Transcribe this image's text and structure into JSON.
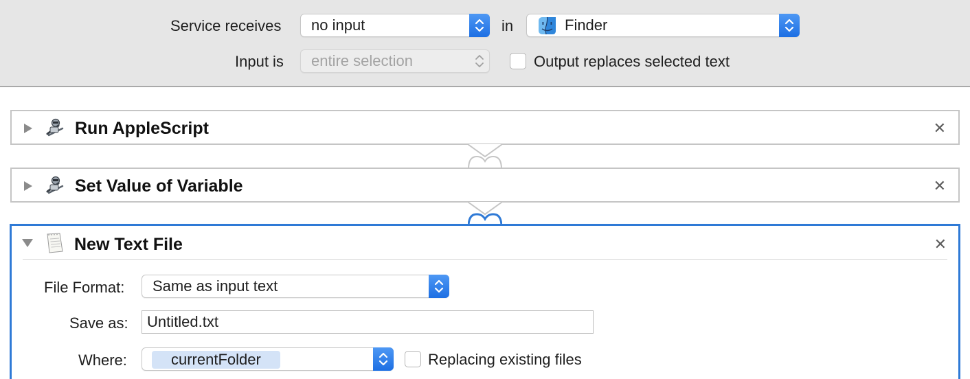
{
  "service": {
    "receives_label": "Service receives",
    "receives_value": "no input",
    "in_label": "in",
    "app_value": "Finder",
    "input_is_label": "Input is",
    "input_is_value": "entire selection",
    "output_replaces_label": "Output replaces selected text",
    "output_replaces_checked": false
  },
  "actions": [
    {
      "title": "Run AppleScript",
      "expanded": false,
      "icon": "script-robot-icon"
    },
    {
      "title": "Set Value of Variable",
      "expanded": false,
      "icon": "script-robot-icon"
    },
    {
      "title": "New Text File",
      "expanded": true,
      "icon": "text-document-icon",
      "file_format_label": "File Format:",
      "file_format_value": "Same as input text",
      "save_as_label": "Save as:",
      "save_as_value": "Untitled.txt",
      "where_label": "Where:",
      "where_value": "currentFolder",
      "replacing_label": "Replacing existing files",
      "replacing_checked": false
    }
  ],
  "colors": {
    "accent": "#2f7ad6",
    "stepper": "#1d6fe3",
    "bar_bg": "#e6e6e6",
    "token_bg": "#d4e3f7"
  }
}
